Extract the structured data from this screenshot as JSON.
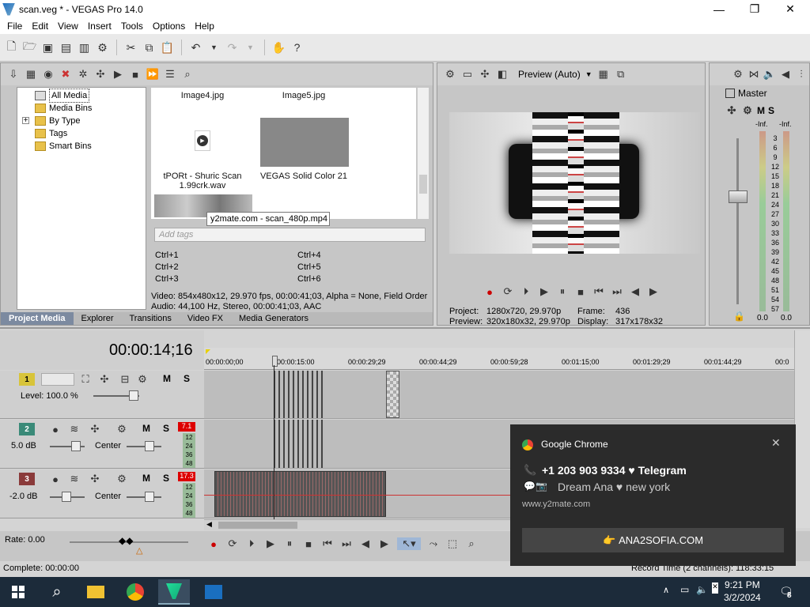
{
  "window": {
    "title": "scan.veg * - VEGAS Pro 14.0",
    "min": "—",
    "max": "❐",
    "close": "✕"
  },
  "menu": [
    "File",
    "Edit",
    "View",
    "Insert",
    "Tools",
    "Options",
    "Help"
  ],
  "media": {
    "tree": [
      "All Media",
      "Media Bins",
      "By Type",
      "Tags",
      "Smart Bins"
    ],
    "thumbs": {
      "image4": "Image4.jpg",
      "image5": "Image5.jpg",
      "wav": "tPORt - Shuric Scan 1.99crk.wav",
      "solid": "VEGAS Solid Color 21"
    },
    "tooltip": "y2mate.com - scan_480p.mp4",
    "tags_placeholder": "Add tags",
    "shortcuts": [
      "Ctrl+1",
      "Ctrl+4",
      "Ctrl+2",
      "Ctrl+5",
      "Ctrl+3",
      "Ctrl+6"
    ],
    "info_video": "Video: 854x480x12, 29.970 fps, 00:00:41;03, Alpha = None, Field Order",
    "info_audio": "Audio: 44,100 Hz, Stereo, 00:00:41;03, AAC",
    "tabs": [
      "Project Media",
      "Explorer",
      "Transitions",
      "Video FX",
      "Media Generators"
    ]
  },
  "preview": {
    "mode": "Preview (Auto)",
    "project_label": "Project:",
    "project_value": "1280x720, 29.970p",
    "preview_label": "Preview:",
    "preview_value": "320x180x32, 29.970p",
    "frame_label": "Frame:",
    "frame_value": "436",
    "display_label": "Display:",
    "display_value": "317x178x32"
  },
  "mixer": {
    "title": "Master",
    "m": "M",
    "s": "S",
    "inf_l": "-Inf.",
    "inf_r": "-Inf.",
    "scale": [
      "3",
      "6",
      "9",
      "12",
      "15",
      "18",
      "21",
      "24",
      "27",
      "30",
      "33",
      "36",
      "39",
      "42",
      "45",
      "48",
      "51",
      "54",
      "57"
    ],
    "val_l": "0.0",
    "val_r": "0.0"
  },
  "timeline": {
    "timecode": "00:00:14;16",
    "ruler": [
      "00:00:00;00",
      "00:00:15:00",
      "00:00:29;29",
      "00:00:44;29",
      "00:00:59;28",
      "00:01:15;00",
      "00:01:29;29",
      "00:01:44;29",
      "00:0"
    ],
    "tracks": [
      {
        "num": "1",
        "level": "Level: 100.0 %",
        "m": "M",
        "s": "S"
      },
      {
        "num": "2",
        "vol": "5.0 dB",
        "pan": "Center",
        "m": "M",
        "s": "S",
        "peak": "7.1"
      },
      {
        "num": "3",
        "vol": "-2.0 dB",
        "pan": "Center",
        "m": "M",
        "s": "S",
        "peak": "17.3"
      }
    ],
    "meter_scale": [
      "12",
      "24",
      "36",
      "48"
    ],
    "rate": "Rate: 0.00",
    "complete": "Complete: 00:00:00",
    "record_time": "Record Time (2 channels): 118:33:15"
  },
  "notification": {
    "app": "Google Chrome",
    "line1": "+1 203 903 9334 ♥ Telegram",
    "line2": "Dream Ana ♥ new york",
    "site": "www.y2mate.com",
    "button": "ANA2SOFIA.COM"
  },
  "taskbar": {
    "time": "9:21 PM",
    "date": "3/2/2024",
    "badge": "8"
  }
}
